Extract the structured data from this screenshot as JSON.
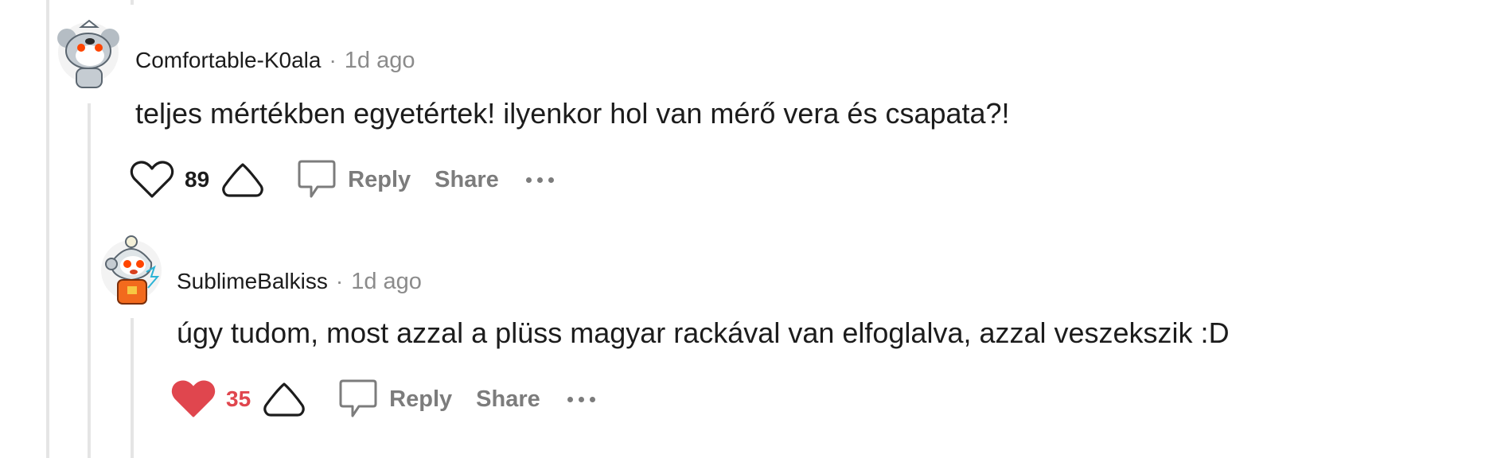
{
  "comments": [
    {
      "author": "Comfortable-K0ala",
      "separator": "·",
      "time": "1d ago",
      "text": "teljes mértékben egyetértek! ilyenkor hol van mérő vera és csapata?!",
      "votes": "89",
      "liked": false,
      "reply_label": "Reply",
      "share_label": "Share"
    },
    {
      "author": "SublimeBalkiss",
      "separator": "·",
      "time": "1d ago",
      "text": "úgy tudom, most azzal a plüss magyar rackával van elfoglalva, azzal veszekszik :D",
      "votes": "35",
      "liked": true,
      "reply_label": "Reply",
      "share_label": "Share"
    }
  ],
  "colors": {
    "liked": "#e0464e",
    "thread_line": "#e5e5e5",
    "meta": "#8b8b8b"
  },
  "icons": [
    "heart-icon",
    "upvote-icon",
    "comment-icon",
    "more-icon"
  ]
}
